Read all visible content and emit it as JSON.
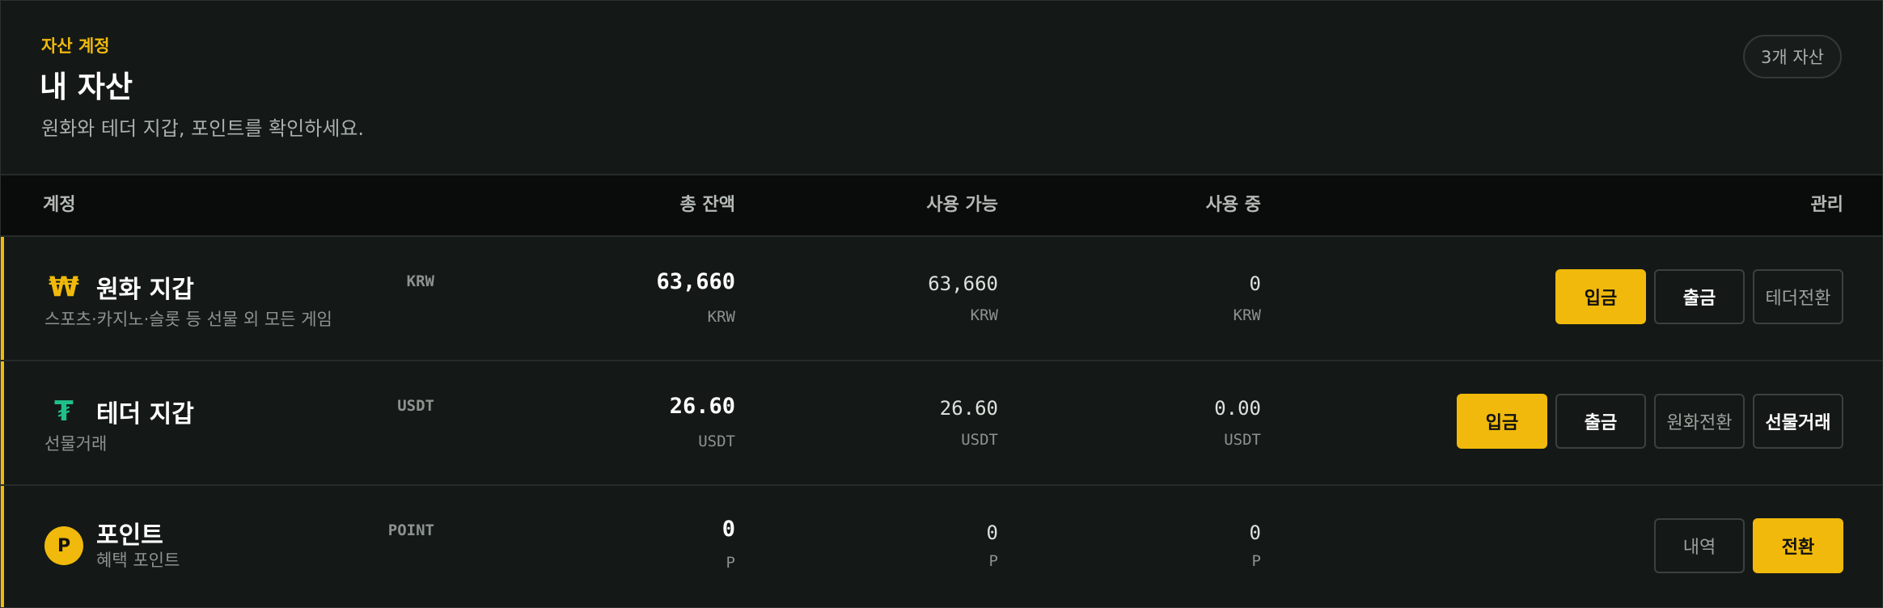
{
  "header": {
    "eyebrow": "자산 계정",
    "title": "내 자산",
    "subtitle": "원화와 테더 지갑, 포인트를 확인하세요.",
    "count_badge": "3개 자산"
  },
  "table": {
    "columns": {
      "account": "계정",
      "total": "총 잔액",
      "available": "사용 가능",
      "in_use": "사용 중",
      "manage": "관리"
    },
    "rows": [
      {
        "icon": "₩",
        "icon_name": "won-icon",
        "name": "원화 지갑",
        "desc": "스포츠·카지노·슬롯 등 선물 외 모든 게임",
        "code": "KRW",
        "total": "63,660",
        "total_unit": "KRW",
        "available": "63,660",
        "available_unit": "KRW",
        "in_use": "0",
        "in_use_unit": "KRW",
        "actions": [
          "입금",
          "출금",
          "테더전환"
        ]
      },
      {
        "icon": "₮",
        "icon_name": "tether-icon",
        "name": "테더 지갑",
        "desc": "선물거래",
        "code": "USDT",
        "total": "26.60",
        "total_unit": "USDT",
        "available": "26.60",
        "available_unit": "USDT",
        "in_use": "0.00",
        "in_use_unit": "USDT",
        "actions": [
          "입금",
          "출금",
          "원화전환",
          "선물거래"
        ]
      },
      {
        "icon": "P",
        "icon_name": "point-icon",
        "name": "포인트",
        "desc": "혜택 포인트",
        "code": "POINT",
        "total": "0",
        "total_unit": "P",
        "available": "0",
        "available_unit": "P",
        "in_use": "0",
        "in_use_unit": "P",
        "actions": [
          "내역",
          "전환"
        ]
      }
    ]
  },
  "colors": {
    "accent": "#f0b90b",
    "tether": "#1fc08a",
    "background": "#141917"
  }
}
